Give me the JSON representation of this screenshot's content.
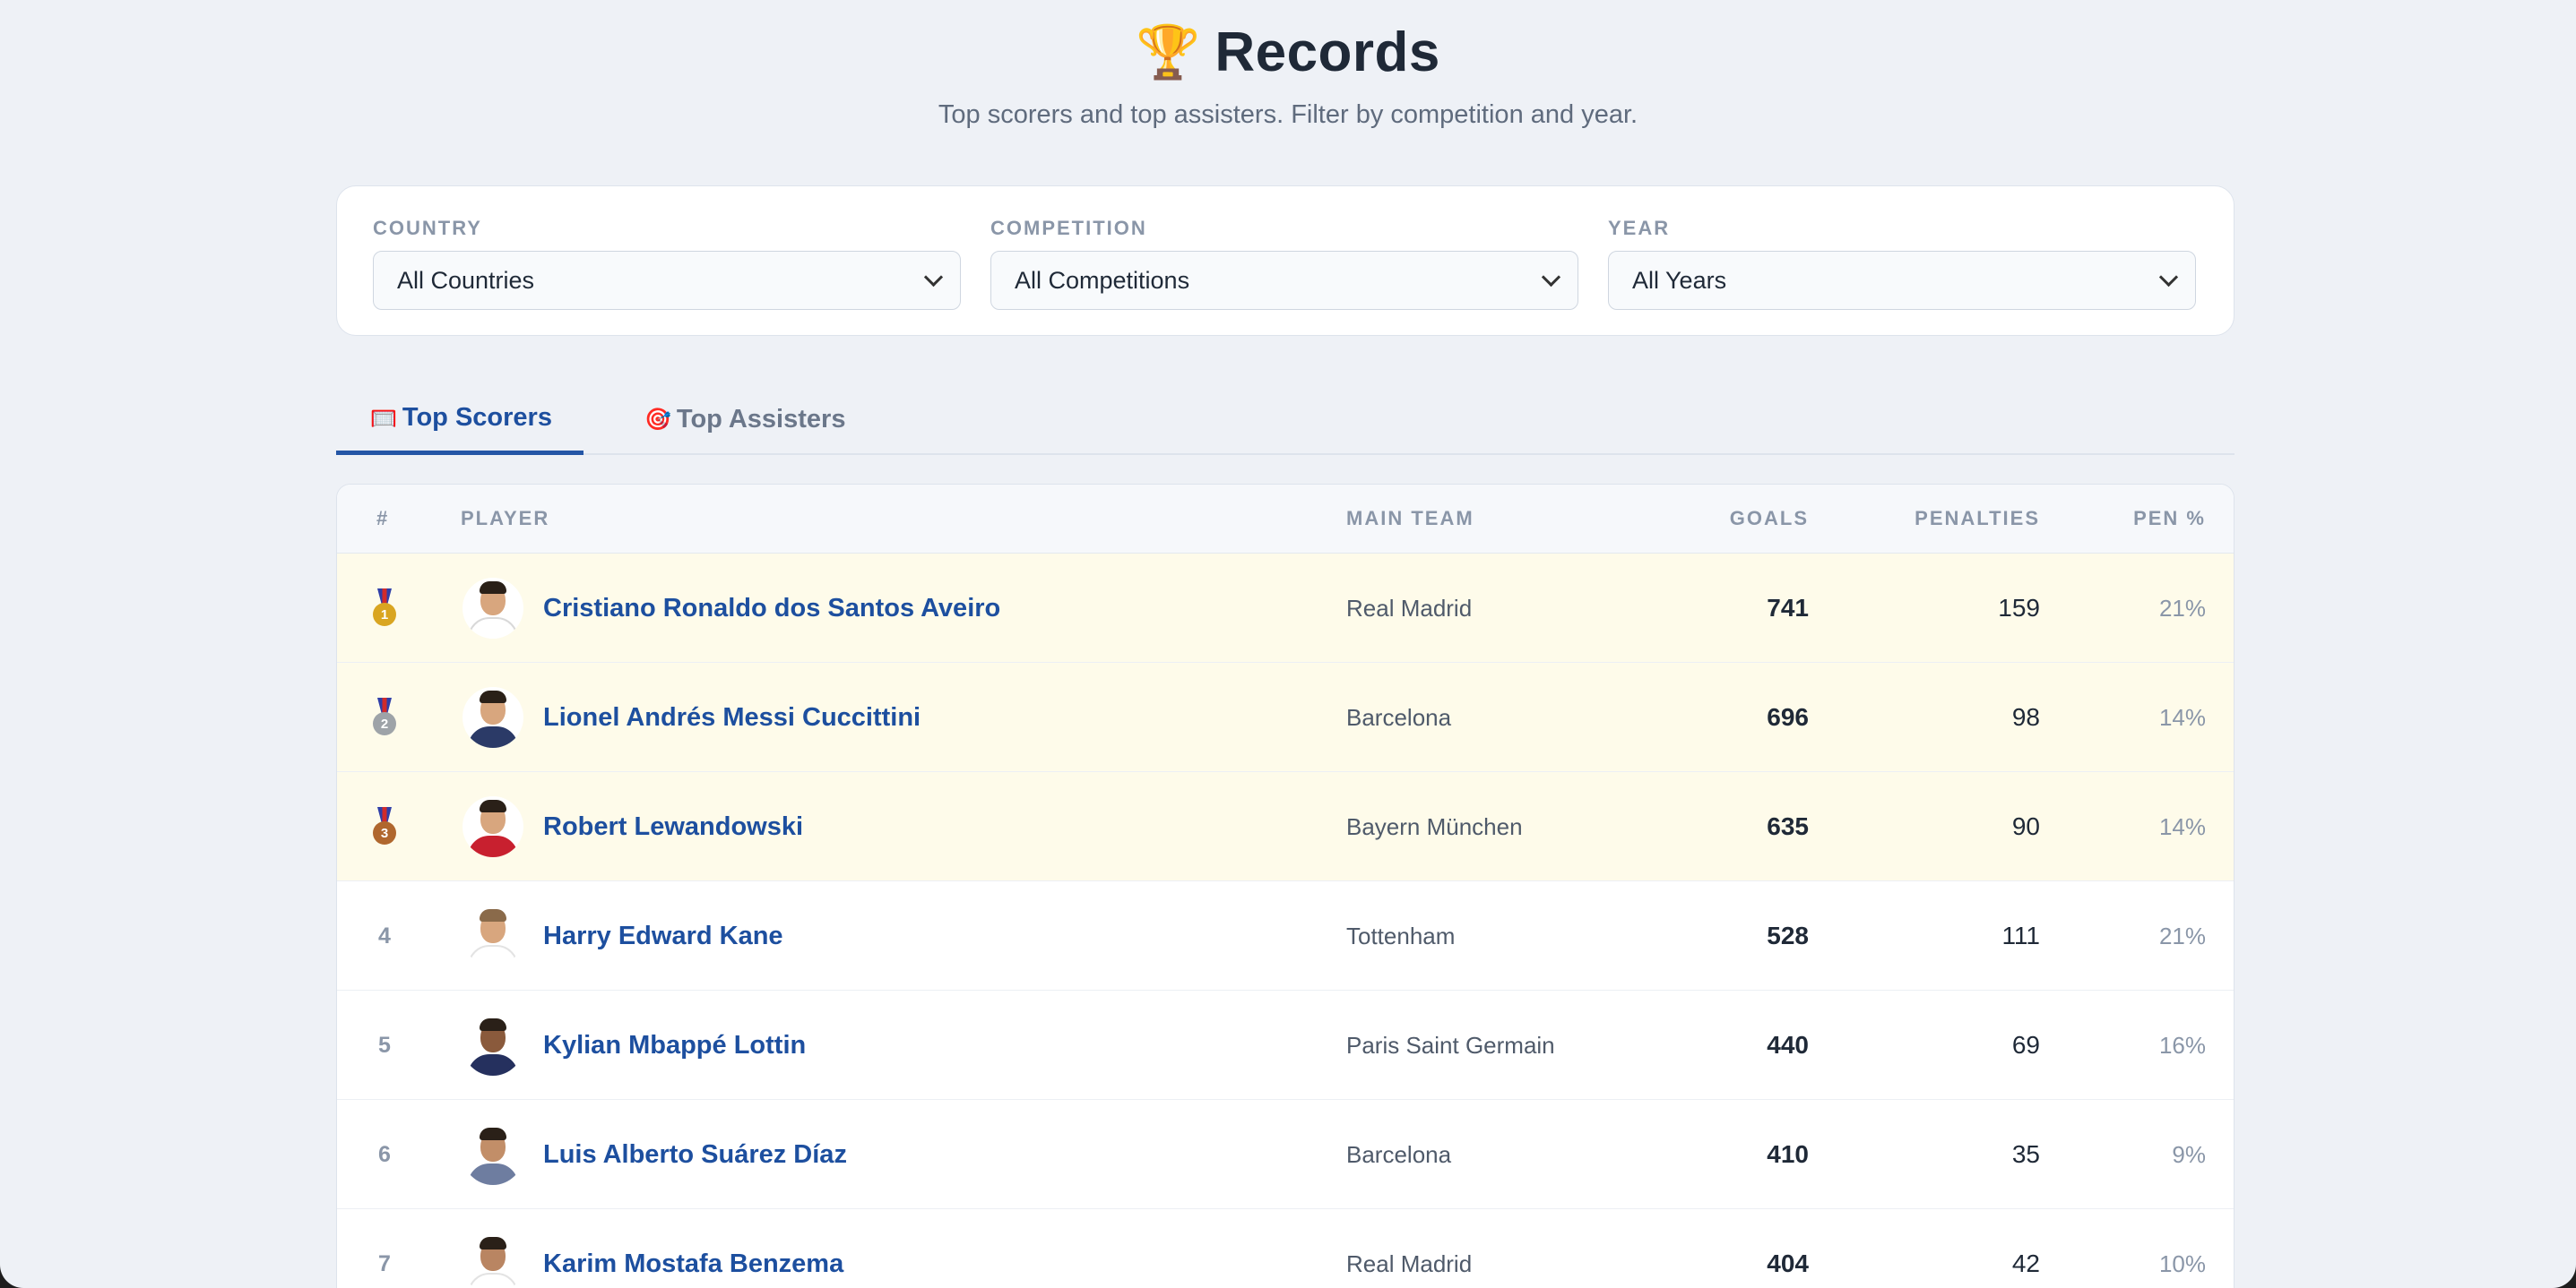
{
  "header": {
    "trophy_icon": "trophy-icon",
    "trophy_glyph": "🏆",
    "title": "Records",
    "subtitle": "Top scorers and top assisters. Filter by competition and year."
  },
  "filters": {
    "country": {
      "label": "COUNTRY",
      "value": "All Countries"
    },
    "competition": {
      "label": "COMPETITION",
      "value": "All Competitions"
    },
    "year": {
      "label": "YEAR",
      "value": "All Years"
    }
  },
  "tabs": [
    {
      "label": "Top Scorers",
      "icon": "goal-net-icon",
      "glyph": "🥅",
      "active": true
    },
    {
      "label": "Top Assisters",
      "icon": "target-icon",
      "glyph": "🎯",
      "active": false
    }
  ],
  "table": {
    "columns": {
      "rank": "#",
      "player": "PLAYER",
      "team": "MAIN TEAM",
      "goals": "GOALS",
      "penalties": "PENALTIES",
      "pen_pct": "PEN %"
    },
    "rows": [
      {
        "rank": "1",
        "medal": "gold-medal-icon",
        "player": "Cristiano Ronaldo dos Santos Aveiro",
        "team": "Real Madrid",
        "goals": "741",
        "penalties": "159",
        "pen_pct": "21%"
      },
      {
        "rank": "2",
        "medal": "silver-medal-icon",
        "player": "Lionel Andrés Messi Cuccittini",
        "team": "Barcelona",
        "goals": "696",
        "penalties": "98",
        "pen_pct": "14%"
      },
      {
        "rank": "3",
        "medal": "bronze-medal-icon",
        "player": "Robert Lewandowski",
        "team": "Bayern München",
        "goals": "635",
        "penalties": "90",
        "pen_pct": "14%"
      },
      {
        "rank": "4",
        "player": "Harry Edward Kane",
        "team": "Tottenham",
        "goals": "528",
        "penalties": "111",
        "pen_pct": "21%"
      },
      {
        "rank": "5",
        "player": "Kylian Mbappé Lottin",
        "team": "Paris Saint Germain",
        "goals": "440",
        "penalties": "69",
        "pen_pct": "16%"
      },
      {
        "rank": "6",
        "player": "Luis Alberto Suárez Díaz",
        "team": "Barcelona",
        "goals": "410",
        "penalties": "35",
        "pen_pct": "9%"
      },
      {
        "rank": "7",
        "player": "Karim Mostafa Benzema",
        "team": "Real Madrid",
        "goals": "404",
        "penalties": "42",
        "pen_pct": "10%"
      }
    ]
  },
  "colors": {
    "accent": "#1d4f9f",
    "page_bg": "#eef1f6",
    "podium_bg": "#fefbea",
    "gold": "#d9a521",
    "silver": "#9ea3a8",
    "bronze": "#b0672e"
  }
}
